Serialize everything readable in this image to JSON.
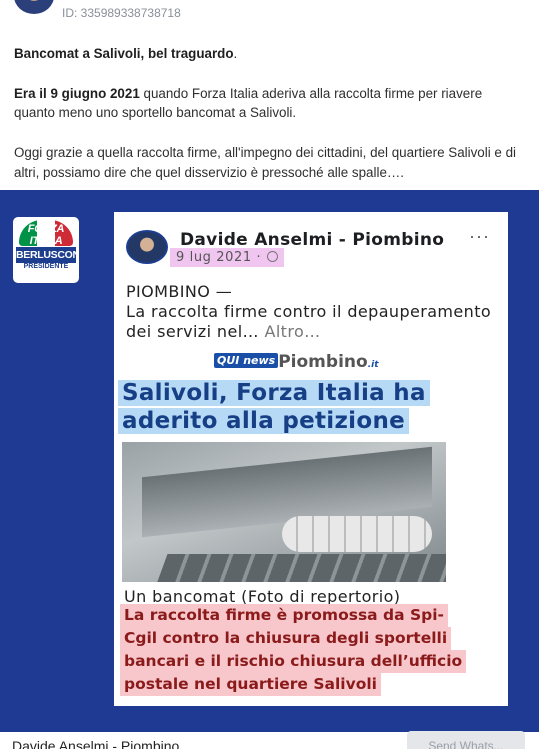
{
  "ad": {
    "id_label": "ID: 335989338738718"
  },
  "post": {
    "line1_bold": "Bancomat a Salivoli, bel traguardo",
    "line1_end": ".",
    "para2_bold": "Era il 9 giugno 2021",
    "para2_text": " quando Forza Italia aderiva alla raccolta firme per riavere quanto meno uno sportello bancomat a Salivoli.",
    "para3": "Oggi grazie a quella raccolta firme, all'impegno dei cittadini, del quartiere Salivoli e di altri, possiamo dire che quel disservizio è pressoché alle spalle…."
  },
  "logo": {
    "top_text": "FORZA ITALIA",
    "name": "BERLUSCONI",
    "subtitle": "PRESIDENTE",
    "colors": [
      "#009246",
      "#ffffff",
      "#ce2b37"
    ]
  },
  "fb_post": {
    "author": "Davide Anselmi - Piombino",
    "date": "9 lug 2021 ·",
    "menu_icon": "···",
    "location": "PIOMBINO —",
    "body": "La raccolta firme contro il depauperamento dei servizi nel…",
    "more": "Altro…",
    "source_box": "QUI news",
    "source_name": "Piombino",
    "source_tld": ".it",
    "headline_1": "Salivoli, Forza Italia ha",
    "headline_2": "aderito alla petizione",
    "caption": "Un bancomat (Foto di repertorio)",
    "highlight_lines": [
      "La raccolta firme è promossa da Spi-",
      "Cgil contro la chiusura degli sportelli",
      "bancari e il rischio chiusura dell’ufficio",
      "postale nel quartiere Salivoli"
    ]
  },
  "footer": {
    "author": "Davide Anselmi - Piombino",
    "button": "Send Whats..."
  },
  "colors": {
    "ad_background": "#1f3a93",
    "date_highlight": "#f0c6f0",
    "headline_highlight": "#b6d9f5",
    "headline_text": "#163f86",
    "pink_highlight": "#f7c7cc"
  }
}
